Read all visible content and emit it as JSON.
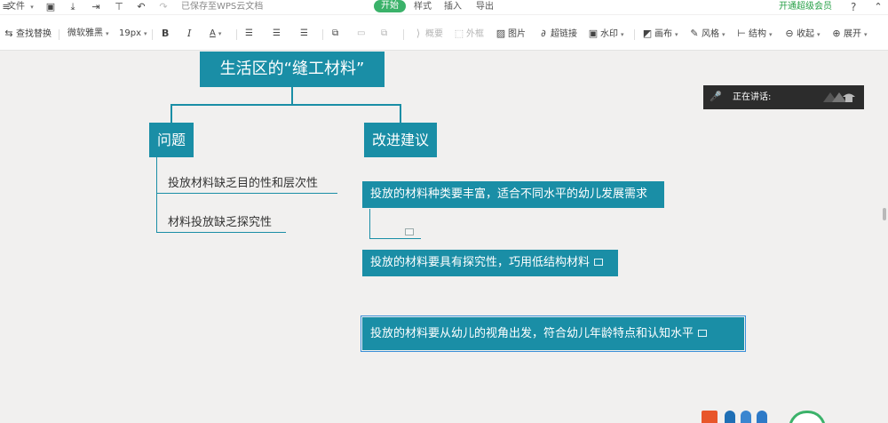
{
  "menubar": {
    "file_label": "文件",
    "saved_status": "已保存至WPS云文档",
    "tabs": [
      "开始",
      "样式",
      "插入",
      "导出"
    ],
    "vip_label": "开通超级会员",
    "help_label": "?"
  },
  "toolbar": {
    "find_replace": "查找替换",
    "font_family": "微软雅黑",
    "font_size": "19px",
    "bold": "B",
    "italic": "I",
    "font_color": "A",
    "summary": "概要",
    "outer_frame": "外框",
    "image": "图片",
    "hyperlink": "超链接",
    "watermark": "水印",
    "canvas": "画布",
    "style": "风格",
    "structure": "结构",
    "collapse": "收起",
    "expand": "展开"
  },
  "mindmap": {
    "root": "生活区的“缝工材料”",
    "problems": {
      "label": "问题",
      "items": [
        "投放材料缺乏目的性和层次性",
        "材料投放缺乏探究性"
      ]
    },
    "suggestions": {
      "label": "改进建议",
      "items": [
        "投放的材料种类要丰富，适合不同水平的幼儿发展需求",
        "投放的材料要具有探究性，巧用低结构材料",
        "投放的材料要从幼儿的视角出发，符合幼儿年龄特点和认知水平"
      ]
    }
  },
  "speaking_popup": {
    "label": "正在讲话:"
  },
  "colors": {
    "node_bg": "#1a8ea6",
    "canvas_bg": "#f1f0ef",
    "accent_green": "#3bb26a"
  }
}
